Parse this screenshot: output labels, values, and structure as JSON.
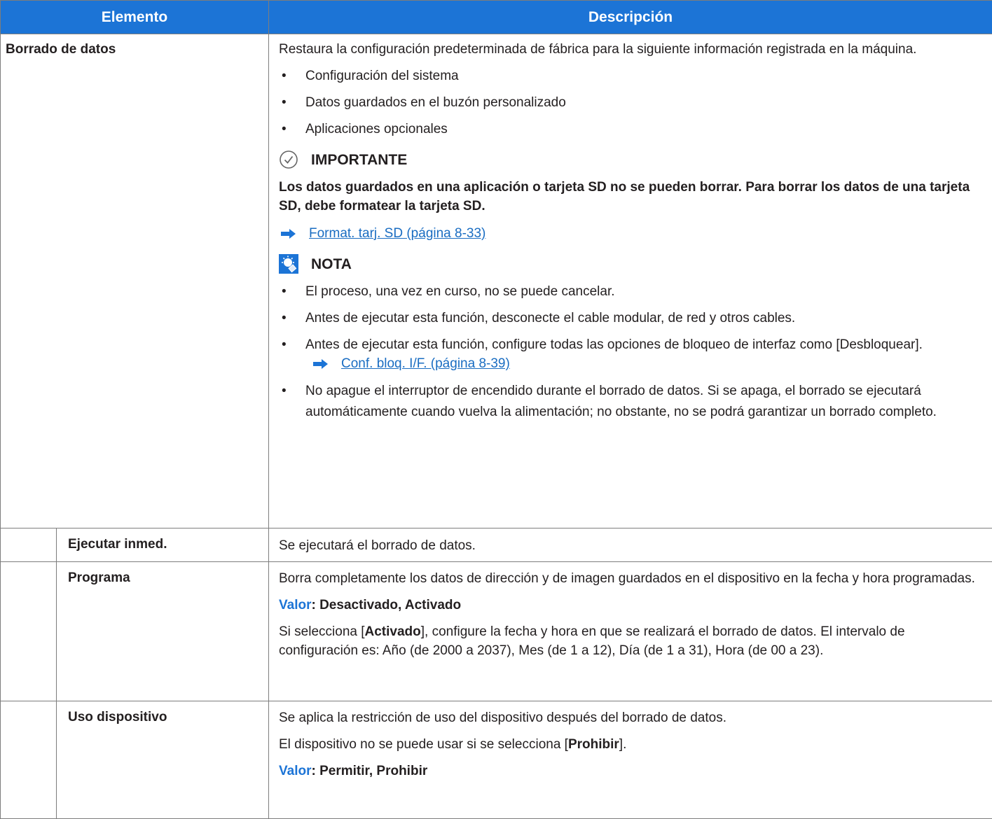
{
  "header": {
    "col1": "Elemento",
    "col2": "Descripción"
  },
  "borrado": {
    "label": "Borrado de datos",
    "intro": "Restaura la configuración predeterminada de fábrica para la siguiente información registrada en la máquina.",
    "bullets": [
      "Configuración del sistema",
      "Datos guardados en el buzón personalizado",
      "Aplicaciones opcionales"
    ],
    "important_title": "IMPORTANTE",
    "important_text": "Los datos guardados en una aplicación o tarjeta SD no se pueden borrar. Para borrar los datos de una tarjeta SD, debe formatear la tarjeta SD.",
    "link1": "Format. tarj. SD (página 8-33)",
    "note_title": "NOTA",
    "note_bullet1": "El proceso, una vez en curso, no se puede cancelar.",
    "note_bullet2": "Antes de ejecutar esta función, desconecte el cable modular, de red y otros cables.",
    "note_bullet3": "Antes de ejecutar esta función, configure todas las opciones de bloqueo de interfaz como [Desbloquear].",
    "link2": "Conf. bloq. I/F. (página 8-39)",
    "note_bullet4": "No apague el interruptor de encendido durante el borrado de datos. Si se apaga, el borrado se ejecutará automáticamente cuando vuelva la alimentación; no obstante, no se podrá garantizar un borrado completo."
  },
  "ejecutar": {
    "label": "Ejecutar inmed.",
    "desc": "Se ejecutará el borrado de datos."
  },
  "programa": {
    "label": "Programa",
    "desc": "Borra completamente los datos de dirección y de imagen guardados en el dispositivo en la fecha y hora programadas.",
    "value_label": "Valor",
    "value_text": ": Desactivado, Activado",
    "sel_pre": "Si selecciona [",
    "sel_bold": "Activado",
    "sel_post": "], configure la fecha y hora en que se realizará el borrado de datos. El intervalo de configuración es: Año (de 2000 a 2037), Mes (de 1 a 12), Día (de 1 a 31), Hora (de 00 a 23)."
  },
  "uso": {
    "label": "Uso dispositivo",
    "desc": "Se aplica la restricción de uso del dispositivo después del borrado de datos.",
    "sel_pre": "El dispositivo no se puede usar si se selecciona [",
    "sel_bold": "Prohibir",
    "sel_post": "].",
    "value_label": "Valor",
    "value_text": ": Permitir, Prohibir"
  },
  "colors": {
    "header_bg": "#1c74d6",
    "link": "#1a6dc2",
    "border": "#7d7d7d"
  },
  "icons": {
    "important": "check-circle-icon",
    "note": "lightbulb-icon",
    "link": "arrow-right-icon"
  }
}
